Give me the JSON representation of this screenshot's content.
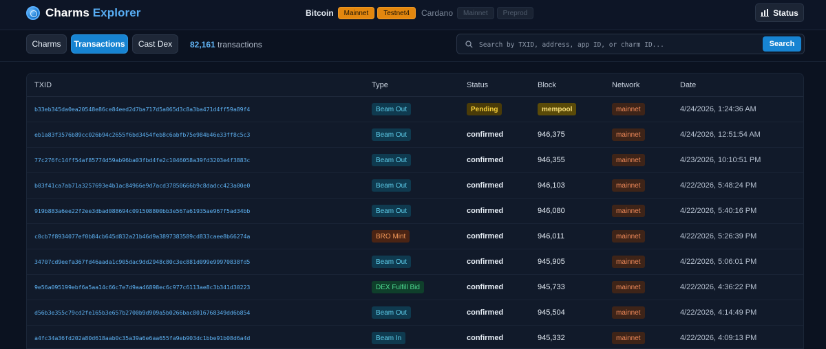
{
  "app": {
    "title_part1": "Charms",
    "title_part2": "Explorer"
  },
  "networks": {
    "bitcoin": {
      "label": "Bitcoin",
      "options": [
        "Mainnet",
        "Testnet4"
      ]
    },
    "cardano": {
      "label": "Cardano",
      "options": [
        "Mainnet",
        "Preprod"
      ]
    }
  },
  "status_button": "Status",
  "tabs": [
    "Charms",
    "Transactions",
    "Cast Dex"
  ],
  "tx_count": {
    "number": "82,161",
    "suffix": "transactions"
  },
  "search": {
    "placeholder": "Search by TXID, address, app ID, or charm ID...",
    "button": "Search"
  },
  "table": {
    "columns": [
      "TXID",
      "Type",
      "Status",
      "Block",
      "Network",
      "Date"
    ],
    "rows": [
      {
        "txid": "b33eb345da0ea20548e86ce84eed2d7ba717d5a065d3c8a3ba471d4ff59a89f4",
        "type": "Beam Out",
        "status": "Pending",
        "block": "mempool",
        "network": "mainnet",
        "date": "4/24/2026, 1:24:36 AM"
      },
      {
        "txid": "eb1a83f3576b89cc026b94c2655f6bd3454feb8c6abfb75e984b46e33ff8c5c3",
        "type": "Beam Out",
        "status": "confirmed",
        "block": "946,375",
        "network": "mainnet",
        "date": "4/24/2026, 12:51:54 AM"
      },
      {
        "txid": "77c276fc14ff54af85774d59ab96ba03fbd4fe2c1046058a39fd3203e4f3883c",
        "type": "Beam Out",
        "status": "confirmed",
        "block": "946,355",
        "network": "mainnet",
        "date": "4/23/2026, 10:10:51 PM"
      },
      {
        "txid": "b03f41ca7ab71a3257693e4b1ac84966e9d7acd37850666b9c8dadcc423a00e0",
        "type": "Beam Out",
        "status": "confirmed",
        "block": "946,103",
        "network": "mainnet",
        "date": "4/22/2026, 5:48:24 PM"
      },
      {
        "txid": "919b883a6ee22f2ee3dbad088694c091508800bb3e567a61935ae967f5ad34bb",
        "type": "Beam Out",
        "status": "confirmed",
        "block": "946,080",
        "network": "mainnet",
        "date": "4/22/2026, 5:40:16 PM"
      },
      {
        "txid": "c0cb7f8934077ef0b84cb645d832a21b46d9a3897383589cd833caee8b66274a",
        "type": "BRO Mint",
        "status": "confirmed",
        "block": "946,011",
        "network": "mainnet",
        "date": "4/22/2026, 5:26:39 PM"
      },
      {
        "txid": "34707cd9eefa367fd46aada1c905dac9dd2948c80c3ec881d099e99970838fd5",
        "type": "Beam Out",
        "status": "confirmed",
        "block": "945,905",
        "network": "mainnet",
        "date": "4/22/2026, 5:06:01 PM"
      },
      {
        "txid": "9e56a095199ebf6a5aa14c66c7e7d9aa46898ec6c977c6113ae8c3b341d30223",
        "type": "DEX Fulfill Bid",
        "status": "confirmed",
        "block": "945,733",
        "network": "mainnet",
        "date": "4/22/2026, 4:36:22 PM"
      },
      {
        "txid": "d56b3e355c79cd2fe165b3e657b2700b9d909a5b0266bac8016768349dd6b854",
        "type": "Beam Out",
        "status": "confirmed",
        "block": "945,504",
        "network": "mainnet",
        "date": "4/22/2026, 4:14:49 PM"
      },
      {
        "txid": "a4fc34a36fd202a80d618aab0c35a39a6e6aa655fa9eb903dc1bbe91b08d6a4d",
        "type": "Beam In",
        "status": "confirmed",
        "block": "945,332",
        "network": "mainnet",
        "date": "4/22/2026, 4:09:13 PM"
      }
    ]
  }
}
